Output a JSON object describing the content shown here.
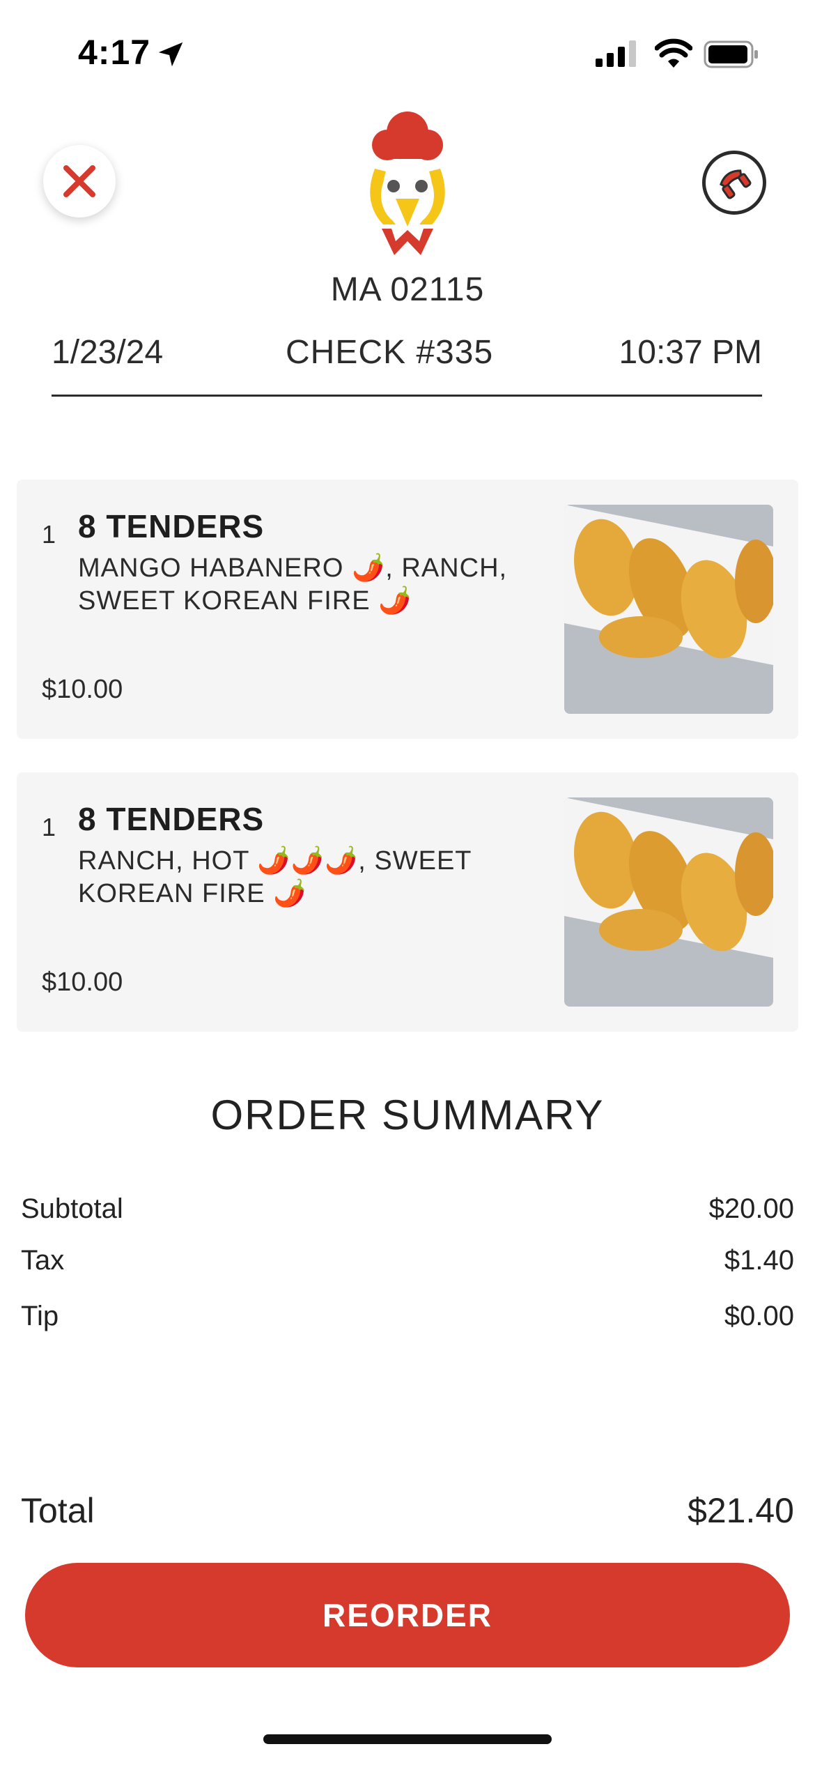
{
  "status_bar": {
    "time": "4:17"
  },
  "header": {
    "zip": "MA 02115",
    "date": "1/23/24",
    "check": "CHECK #335",
    "time": "10:37 PM"
  },
  "items": [
    {
      "qty": "1",
      "name": "8 TENDERS",
      "mods_parts": [
        "MANGO HABANERO ",
        ", RANCH, SWEET KOREAN FIRE "
      ],
      "mods_peppers": [
        "🌶️",
        "🌶️"
      ],
      "price": "$10.00"
    },
    {
      "qty": "1",
      "name": "8 TENDERS",
      "mods_parts": [
        "RANCH, HOT ",
        ", SWEET KOREAN FIRE "
      ],
      "mods_peppers": [
        "🌶️🌶️🌶️",
        "🌶️"
      ],
      "price": "$10.00"
    }
  ],
  "summary": {
    "title": "ORDER SUMMARY",
    "subtotal_label": "Subtotal",
    "subtotal": "$20.00",
    "tax_label": "Tax",
    "tax": "$1.40",
    "tip_label": "Tip",
    "tip": "$0.00",
    "total_label": "Total",
    "total": "$21.40"
  },
  "actions": {
    "reorder": "REORDER"
  },
  "colors": {
    "accent": "#d63a2c",
    "card_bg": "#f5f5f5",
    "logo_yellow": "#f5c518"
  },
  "icons": [
    "location-arrow-icon",
    "signal-icon",
    "wifi-icon",
    "battery-icon",
    "close-icon",
    "phone-icon"
  ]
}
